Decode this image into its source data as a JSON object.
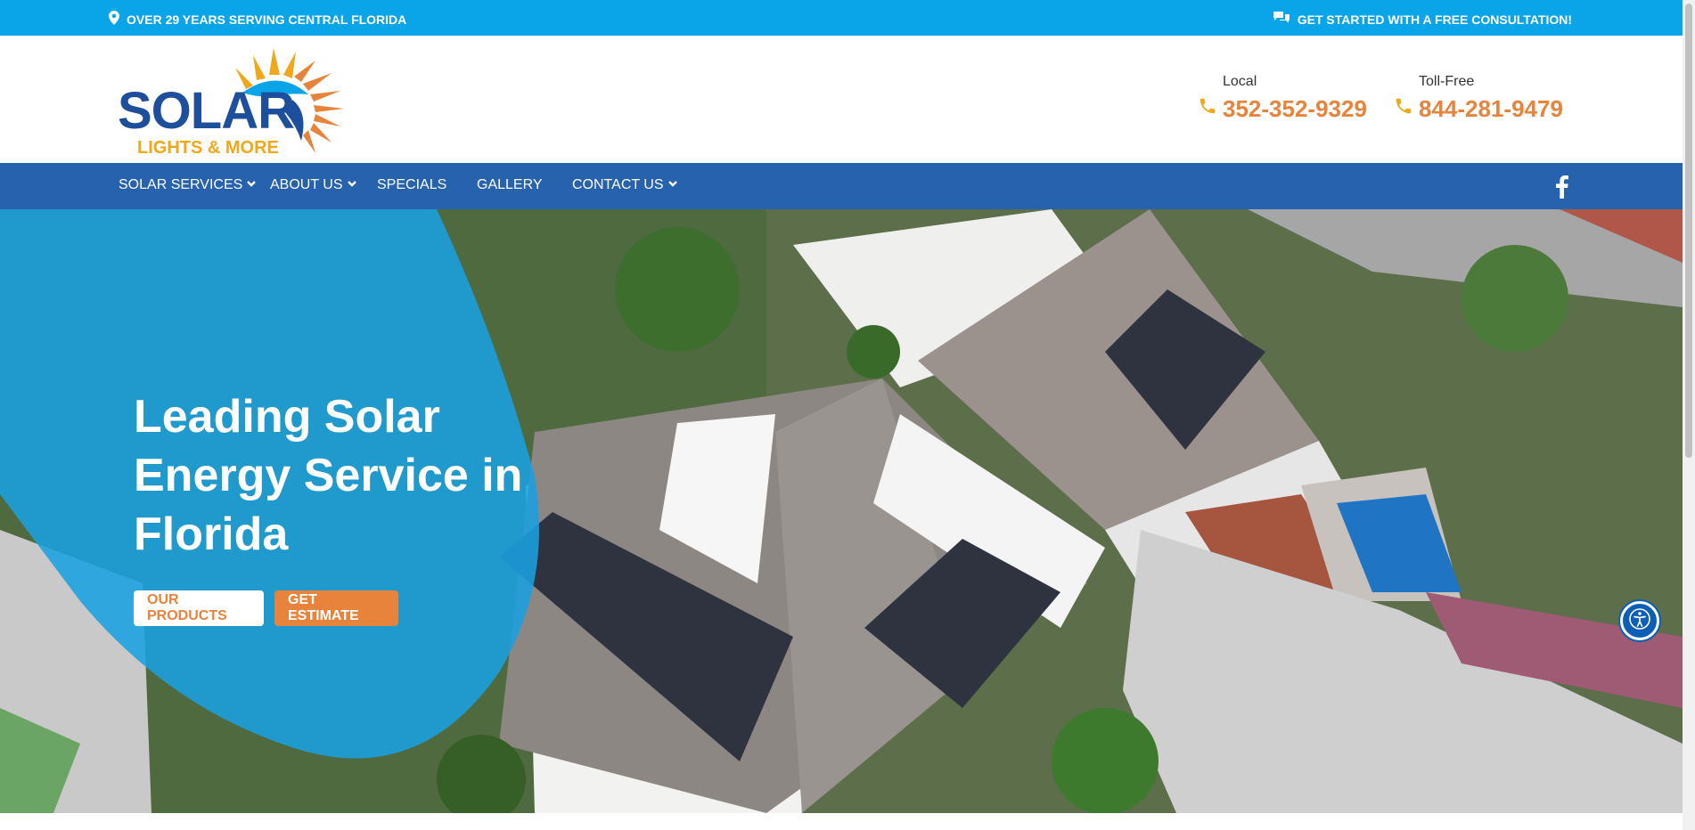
{
  "topbar": {
    "left_text": "OVER 29 YEARS SERVING CENTRAL FLORIDA",
    "left_icon": "map-pin-icon",
    "right_text": "GET STARTED WITH A FREE CONSULTATION!",
    "right_icon": "chat-bubbles-icon"
  },
  "logo": {
    "word": "SOLAR",
    "sub": "LIGHTS & MORE"
  },
  "phones": [
    {
      "label": "Local",
      "number": "352-352-9329",
      "icon": "phone-icon"
    },
    {
      "label": "Toll-Free",
      "number": "844-281-9479",
      "icon": "phone-icon"
    }
  ],
  "nav": {
    "items": [
      {
        "label": "SOLAR SERVICES",
        "has_dropdown": true
      },
      {
        "label": "ABOUT US",
        "has_dropdown": true
      },
      {
        "label": "SPECIALS",
        "has_dropdown": false
      },
      {
        "label": "GALLERY",
        "has_dropdown": false
      },
      {
        "label": "CONTACT US",
        "has_dropdown": true
      }
    ],
    "social_icon": "facebook-icon"
  },
  "hero": {
    "title": "Leading Solar Energy Service in Florida",
    "buttons": {
      "primary": "OUR PRODUCTS",
      "secondary": "GET ESTIMATE"
    }
  },
  "accessibility_icon": "accessibility-icon",
  "colors": {
    "topbar": "#0aa5e8",
    "nav": "#2662ad",
    "accent_orange": "#e8833b",
    "logo_blue": "#1e4f9c",
    "logo_yellow": "#f0a71a",
    "hero_blob": "#1aa0e0"
  }
}
